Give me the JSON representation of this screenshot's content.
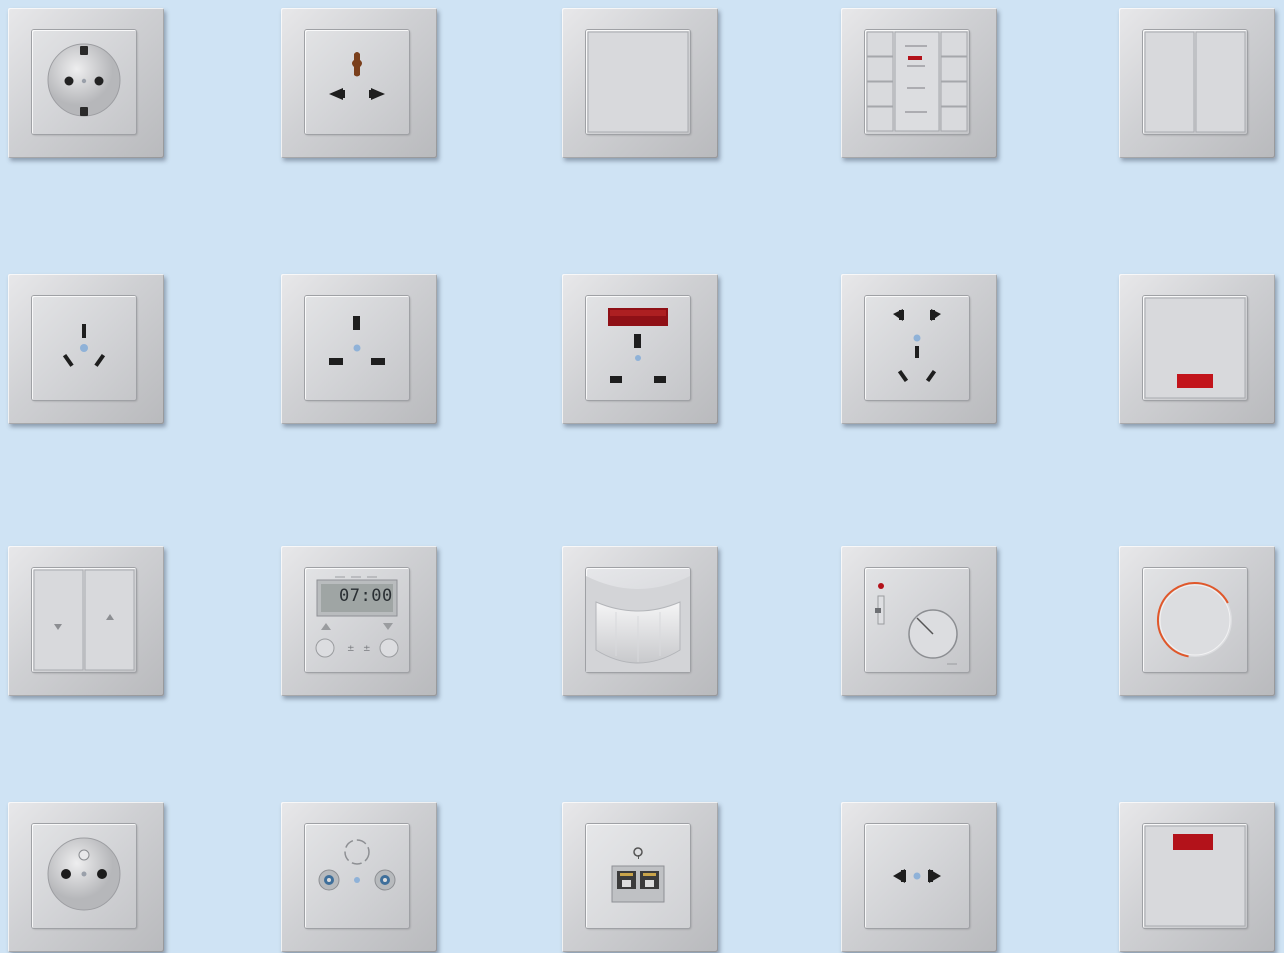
{
  "background_color": "#cfe3f4",
  "accent_colors": {
    "indicator_red": "#b3121a",
    "dimmer_ring": "#e0572a",
    "plate_silver": "#cfd0d3"
  },
  "lcd_time": "07:00",
  "rows": [
    [
      "schuko-socket",
      "multi-standard-socket",
      "single-rocker-switch",
      "push-button-panel",
      "double-rocker-switch"
    ],
    [
      "australian-socket",
      "british-socket",
      "british-socket-with-indicator",
      "chinese-combi-socket",
      "rocker-switch-with-indicator"
    ],
    [
      "blind-switch",
      "digital-timer",
      "motion-detector",
      "room-thermostat",
      "rotary-dimmer"
    ],
    [
      "french-socket",
      "antenna-outlet",
      "network-data-outlet",
      "euro-socket",
      "switch-with-indicator"
    ]
  ]
}
